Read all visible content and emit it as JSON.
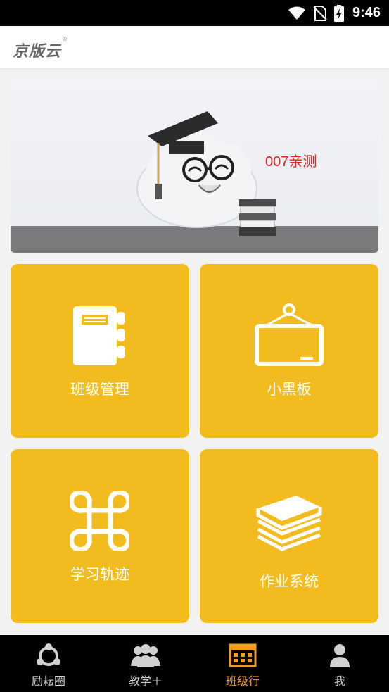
{
  "status_bar": {
    "time": "9:46"
  },
  "header": {
    "logo_text": "京版云",
    "reg_mark": "®"
  },
  "banner": {
    "caption": "007亲测"
  },
  "tiles": [
    {
      "label": "班级管理",
      "icon": "notebook-icon"
    },
    {
      "label": "小黑板",
      "icon": "blackboard-icon"
    },
    {
      "label": "学习轨迹",
      "icon": "command-icon"
    },
    {
      "label": "作业系统",
      "icon": "books-stack-icon"
    }
  ],
  "tab_bar": {
    "tabs": [
      {
        "label": "励耘圈",
        "icon": "circle-network-icon",
        "active": false
      },
      {
        "label": "教学＋",
        "icon": "group-icon",
        "active": false
      },
      {
        "label": "班级行",
        "icon": "calendar-grid-icon",
        "active": true
      },
      {
        "label": "我",
        "icon": "person-icon",
        "active": false
      }
    ]
  },
  "colors": {
    "tile": "#f2bc1f",
    "active_tab": "#f39b1c",
    "caption": "#e0201a"
  }
}
